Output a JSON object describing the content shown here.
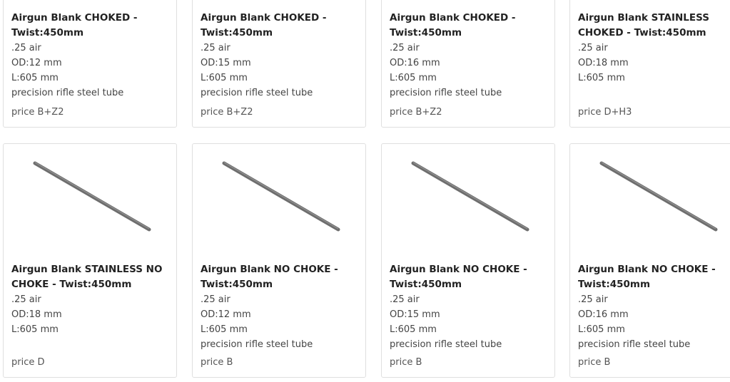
{
  "products": [
    {
      "title": "Airgun Blank CHOKED - Twist:450mm",
      "caliber": ".25 air",
      "od": "OD:12 mm",
      "length": "L:605 mm",
      "material": "precision rifle steel tube",
      "price": "price B+Z2"
    },
    {
      "title": "Airgun Blank CHOKED - Twist:450mm",
      "caliber": ".25 air",
      "od": "OD:15 mm",
      "length": "L:605 mm",
      "material": "precision rifle steel tube",
      "price": "price B+Z2"
    },
    {
      "title": "Airgun Blank CHOKED - Twist:450mm",
      "caliber": ".25 air",
      "od": "OD:16 mm",
      "length": "L:605 mm",
      "material": "precision rifle steel tube",
      "price": "price B+Z2"
    },
    {
      "title": "Airgun Blank STAINLESS CHOKED - Twist:450mm",
      "caliber": ".25 air",
      "od": "OD:18 mm",
      "length": "L:605 mm",
      "material": "",
      "price": "price D+H3"
    },
    {
      "title": "Airgun Blank STAINLESS NO CHOKE - Twist:450mm",
      "caliber": ".25 air",
      "od": "OD:18 mm",
      "length": "L:605 mm",
      "material": "",
      "price": "price D"
    },
    {
      "title": "Airgun Blank NO CHOKE - Twist:450mm",
      "caliber": ".25 air",
      "od": "OD:12 mm",
      "length": "L:605 mm",
      "material": "precision rifle steel tube",
      "price": "price B"
    },
    {
      "title": "Airgun Blank NO CHOKE - Twist:450mm",
      "caliber": ".25 air",
      "od": "OD:15 mm",
      "length": "L:605 mm",
      "material": "precision rifle steel tube",
      "price": "price B"
    },
    {
      "title": "Airgun Blank NO CHOKE - Twist:450mm",
      "caliber": ".25 air",
      "od": "OD:16 mm",
      "length": "L:605 mm",
      "material": "precision rifle steel tube",
      "price": "price B"
    }
  ],
  "image_icon": "steel-tube-icon",
  "colors": {
    "tube": "#6e6e6e",
    "tube_highlight": "#9a9a9a",
    "border": "#dfdfdf"
  }
}
